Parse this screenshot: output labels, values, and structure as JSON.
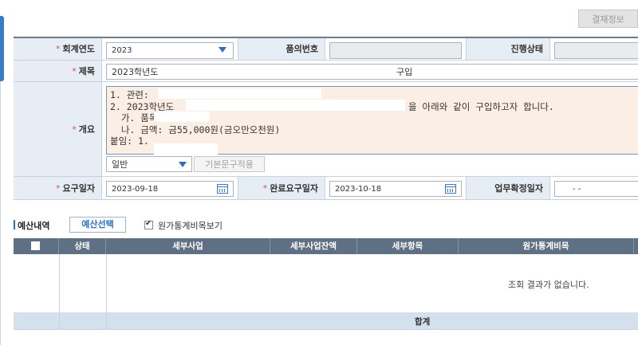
{
  "toolbar": {
    "approval_info_label": "결재정보"
  },
  "form": {
    "fiscal_year": {
      "label": "회계연도",
      "value": "2023"
    },
    "proposal_no": {
      "label": "품의번호",
      "value": ""
    },
    "progress_status": {
      "label": "진행상태",
      "value": ""
    },
    "title": {
      "label": "제목",
      "value_prefix": "2023학년도",
      "value_suffix": "구입"
    },
    "summary": {
      "label": "개요",
      "lines": [
        "1. 관련:",
        "2. 2023학년도",
        "  가. 품목:",
        "  나. 금액: 금55,000원(금오만오천원)",
        "",
        "붙임: 1."
      ],
      "line2_suffix": "을 아래와 같이 구입하고자 합니다."
    },
    "summary_type": {
      "value": "일반"
    },
    "apply_template_label": "기본문구적용",
    "request_date": {
      "label": "요구일자",
      "value": "2023-09-18"
    },
    "completion_request_date": {
      "label": "완료요구일자",
      "value": "2023-10-18"
    },
    "work_confirm_date": {
      "label": "업무확정일자",
      "value": "- -"
    },
    "required_mark": "*"
  },
  "budget": {
    "section_title": "예산내역",
    "select_button_label": "예산선택",
    "show_cost_stats_label": "원가통계비목보기",
    "show_cost_stats_checked": true,
    "columns": [
      "상태",
      "세부사업",
      "세부사업잔액",
      "세부항목",
      "원가통계비목"
    ],
    "empty_message": "조회 결과가 없습니다.",
    "total_label": "합계"
  }
}
